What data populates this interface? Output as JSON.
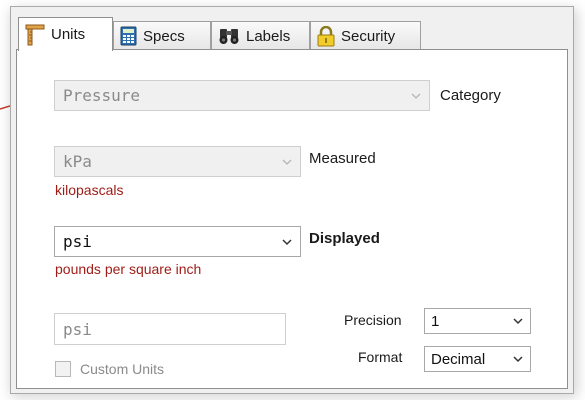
{
  "tabs": [
    {
      "label": "Units",
      "icon": "ruler-icon",
      "active": true
    },
    {
      "label": "Specs",
      "icon": "calculator-icon",
      "active": false
    },
    {
      "label": "Labels",
      "icon": "binoculars-icon",
      "active": false
    },
    {
      "label": "Security",
      "icon": "padlock-icon",
      "active": false
    }
  ],
  "category": {
    "value": "Pressure",
    "label": "Category"
  },
  "measured": {
    "value": "kPa",
    "label": "Measured",
    "description": "kilopascals"
  },
  "displayed": {
    "value": "psi",
    "label": "Displayed",
    "description": "pounds per square inch"
  },
  "custom_units": {
    "input_value": "psi",
    "checkbox_label": "Custom Units"
  },
  "precision": {
    "label": "Precision",
    "value": "1"
  },
  "format": {
    "label": "Format",
    "value": "Decimal"
  },
  "colors": {
    "callout": "#c0392b",
    "description_text": "#9e1b16"
  }
}
